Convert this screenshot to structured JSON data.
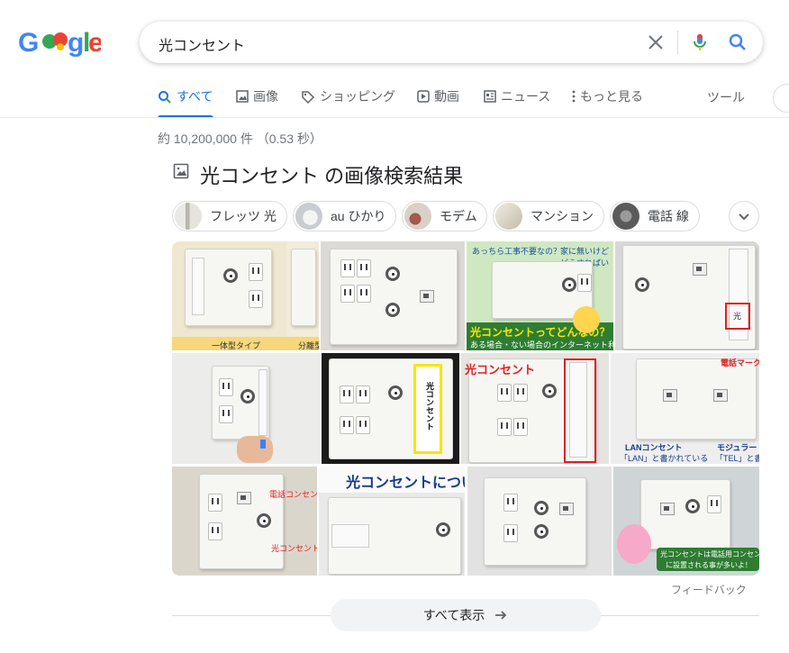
{
  "logo": {
    "letters": [
      "G",
      "o",
      "o",
      "g",
      "l",
      "e"
    ]
  },
  "search": {
    "query": "光コンセント"
  },
  "tabs": [
    {
      "label": "すべて",
      "icon": "search-icon",
      "active": true
    },
    {
      "label": "画像",
      "icon": "image-icon"
    },
    {
      "label": "ショッピング",
      "icon": "tag-icon"
    },
    {
      "label": "動画",
      "icon": "play-icon"
    },
    {
      "label": "ニュース",
      "icon": "newspaper-icon"
    },
    {
      "label": "もっと見る",
      "icon": "more-vert-icon"
    }
  ],
  "tools_label": "ツール",
  "result_stats": "約 10,200,000 件 （0.53 秒）",
  "images_block": {
    "title": "光コンセント の画像検索結果",
    "chips": [
      {
        "label": "フレッツ 光"
      },
      {
        "label": "au ひかり"
      },
      {
        "label": "モデム"
      },
      {
        "label": "マンション"
      },
      {
        "label": "電話 線"
      }
    ],
    "thumb_texts": {
      "t1_left": "一体型タイプ",
      "t1_right": "分離型タ",
      "t3_bubble_left": "あっちら工事不要なの？",
      "t3_bubble_right": "家に無いけど どうすればいい？",
      "t3_heading": "光コンセントってどんなの？",
      "t3_sub": "ある場合・ない場合のインターネット利用法",
      "t4_mark": "光",
      "t6_vertical": "光コンセント",
      "t7_caption": "光コンセント",
      "t8_top": "電話マーク",
      "t8_lan": "LANコンセント",
      "t8_lan_sub": "「LAN」と書かれている",
      "t8_mod": "モジュラー",
      "t8_mod_sub": "「TEL」と書",
      "t9_label1": "電話コンセント",
      "t9_label2": "光コンセント",
      "t10_caption": "光コンセントについ",
      "t12_banner1": "光コンセントは電話用コンセント近く",
      "t12_banner2": "に設置される事が多いよ！"
    },
    "feedback": "フィードバック",
    "show_all": "すべて表示"
  },
  "colors": {
    "accent": "#1a73e8",
    "mic_blue": "#4285f4",
    "mic_red": "#ea4335"
  }
}
